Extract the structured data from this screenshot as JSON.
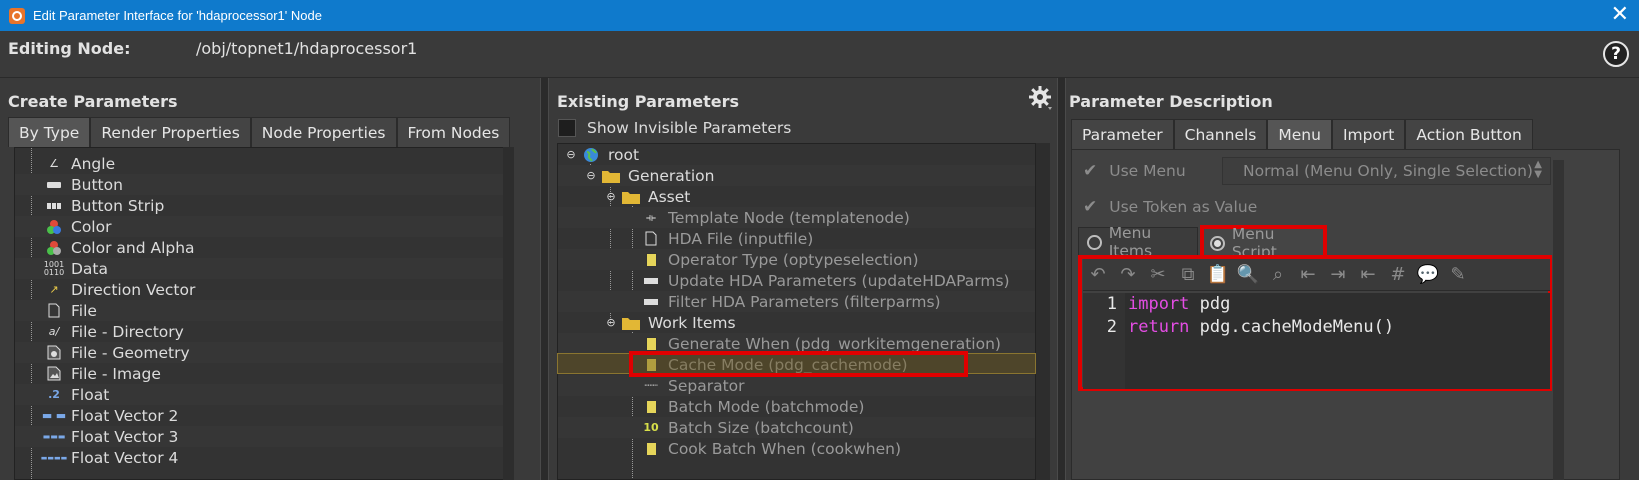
{
  "window": {
    "title": "Edit Parameter Interface for 'hdaprocessor1' Node",
    "close": "✕"
  },
  "editing": {
    "label": "Editing Node:",
    "path": "/obj/topnet1/hdaprocessor1",
    "help": "?"
  },
  "create": {
    "title": "Create Parameters",
    "tabs": [
      "By Type",
      "Render Properties",
      "Node Properties",
      "From Nodes"
    ],
    "items": [
      {
        "label": "Angle",
        "icon": "angle-icon"
      },
      {
        "label": "Button",
        "icon": "button-icon"
      },
      {
        "label": "Button Strip",
        "icon": "button-strip-icon"
      },
      {
        "label": "Color",
        "icon": "color-icon"
      },
      {
        "label": "Color and Alpha",
        "icon": "color-alpha-icon"
      },
      {
        "label": "Data",
        "icon": "data-icon"
      },
      {
        "label": "Direction Vector",
        "icon": "direction-vector-icon"
      },
      {
        "label": "File",
        "icon": "file-icon"
      },
      {
        "label": "File - Directory",
        "icon": "file-directory-icon"
      },
      {
        "label": "File - Geometry",
        "icon": "file-geometry-icon"
      },
      {
        "label": "File - Image",
        "icon": "file-image-icon"
      },
      {
        "label": "Float",
        "icon": "float-icon"
      },
      {
        "label": "Float Vector 2",
        "icon": "float-vector2-icon"
      },
      {
        "label": "Float Vector 3",
        "icon": "float-vector3-icon"
      },
      {
        "label": "Float Vector 4",
        "icon": "float-vector4-icon"
      }
    ]
  },
  "existing": {
    "title": "Existing Parameters",
    "show_invisible": "Show Invisible Parameters",
    "tree": {
      "root": "root",
      "generation": "Generation",
      "asset": "Asset",
      "asset_items": [
        "Template Node (templatenode)",
        "HDA File (inputfile)",
        "Operator Type (optypeselection)",
        "Update HDA Parameters (updateHDAParms)",
        "Filter HDA Parameters (filterparms)"
      ],
      "work_items": "Work Items",
      "work_items_children": [
        "Generate When (pdg_workitemgeneration)",
        "Cache Mode (pdg_cachemode)",
        "Separator",
        "Batch Mode (batchmode)",
        "Batch Size (batchcount)",
        "Cook Batch When (cookwhen)"
      ]
    }
  },
  "description": {
    "title": "Parameter Description",
    "tabs": [
      "Parameter",
      "Channels",
      "Menu",
      "Import",
      "Action Button"
    ],
    "use_menu": "Use Menu",
    "menu_mode": "Normal (Menu Only, Single Selection)",
    "use_token": "Use Token as Value",
    "radio_items": "Menu Items",
    "radio_script": "Menu Script",
    "code_lines": [
      {
        "num": "1",
        "kw": "import",
        "rest": " pdg"
      },
      {
        "num": "2",
        "kw": "return",
        "rest": " pdg.cacheModeMenu()"
      }
    ]
  },
  "colors": {
    "titlebar": "#0f7acc",
    "highlight": "#e00000",
    "keyword": "#e34de3"
  }
}
